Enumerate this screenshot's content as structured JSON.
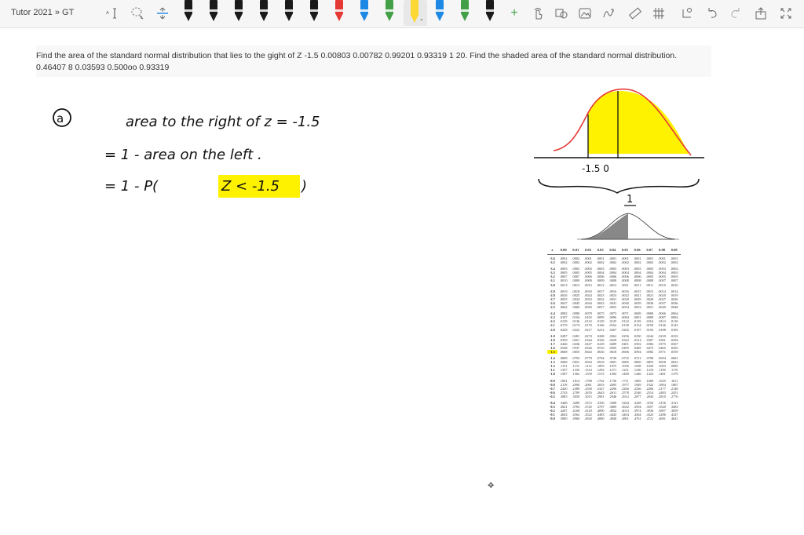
{
  "toolbar": {
    "app_title": "Tutor 2021 » GT",
    "icons": [
      "select-text-icon",
      "lasso-icon",
      "insert-space-icon",
      "pen-icon",
      "plus-icon",
      "touch-icon",
      "shapes-icon",
      "image-icon",
      "math-icon",
      "ruler-icon",
      "eraser-icon",
      "zoom-icon",
      "undo-icon",
      "redo-icon",
      "share-icon",
      "fullscreen-icon"
    ],
    "pen_colors": [
      "#1a1a1a",
      "#1a1a1a",
      "#1a1a1a",
      "#1a1a1a",
      "#1a1a1a",
      "#1a1a1a",
      "#e53935",
      "#1e88e5",
      "#fdd835",
      "#1e88e5",
      "#43a047",
      "#fb8c00",
      "#1a1a1a"
    ],
    "plus_label": "+"
  },
  "question": {
    "text": "Find the area of the standard normal distribution that lies to the gight of Z -1.5 0.00803 0.00782 0.99201 0.93319 1 20. Find the shaded area of the standard normal distribution.",
    "line2": "0.46407 8 0.03593 0.500oo 0.93319"
  },
  "notes": {
    "label_a": "a",
    "line1": "area   to the  right  of   z = -1.5",
    "line2": "= 1  -  area   on the  left .",
    "line3_prefix": "= 1  -   P(",
    "line3_highlight": "Z < -1.5",
    "line3_suffix": ")",
    "curve_label": "-1.5  0",
    "table_ref": "1"
  },
  "ztable": {
    "headers": [
      "z",
      "0.00",
      "0.01",
      "0.02",
      "0.03",
      "0.04",
      "0.05",
      "0.06",
      "0.07",
      "0.08",
      "0.09"
    ],
    "groups": [
      [
        [
          "-3.6",
          ".0002",
          ".0002",
          ".0001",
          ".0001",
          ".0001",
          ".0001",
          ".0001",
          ".0001",
          ".0001",
          ".0001"
        ],
        [
          "-3.5",
          ".0002",
          ".0002",
          ".0002",
          ".0002",
          ".0002",
          ".0002",
          ".0002",
          ".0002",
          ".0002",
          ".0002"
        ]
      ],
      [
        [
          "-3.4",
          ".0003",
          ".0003",
          ".0003",
          ".0003",
          ".0003",
          ".0003",
          ".0003",
          ".0003",
          ".0003",
          ".0002"
        ],
        [
          "-3.3",
          ".0005",
          ".0005",
          ".0005",
          ".0004",
          ".0004",
          ".0004",
          ".0004",
          ".0004",
          ".0004",
          ".0003"
        ],
        [
          "-3.2",
          ".0007",
          ".0007",
          ".0006",
          ".0006",
          ".0006",
          ".0006",
          ".0006",
          ".0005",
          ".0005",
          ".0005"
        ],
        [
          "-3.1",
          ".0010",
          ".0009",
          ".0009",
          ".0009",
          ".0008",
          ".0008",
          ".0008",
          ".0008",
          ".0007",
          ".0007"
        ],
        [
          "-3.0",
          ".0013",
          ".0013",
          ".0013",
          ".0012",
          ".0012",
          ".0011",
          ".0011",
          ".0011",
          ".0010",
          ".0010"
        ]
      ],
      [
        [
          "-2.9",
          ".0019",
          ".0018",
          ".0018",
          ".0017",
          ".0016",
          ".0016",
          ".0015",
          ".0015",
          ".0014",
          ".0014"
        ],
        [
          "-2.8",
          ".0026",
          ".0025",
          ".0024",
          ".0023",
          ".0023",
          ".0022",
          ".0021",
          ".0021",
          ".0020",
          ".0019"
        ],
        [
          "-2.7",
          ".0035",
          ".0034",
          ".0033",
          ".0032",
          ".0031",
          ".0030",
          ".0029",
          ".0028",
          ".0027",
          ".0026"
        ],
        [
          "-2.6",
          ".0047",
          ".0045",
          ".0044",
          ".0043",
          ".0041",
          ".0040",
          ".0039",
          ".0038",
          ".0037",
          ".0036"
        ],
        [
          "-2.5",
          ".0062",
          ".0060",
          ".0059",
          ".0057",
          ".0055",
          ".0054",
          ".0052",
          ".0051",
          ".0049",
          ".0048"
        ]
      ],
      [
        [
          "-2.4",
          ".0082",
          ".0080",
          ".0078",
          ".0075",
          ".0073",
          ".0071",
          ".0069",
          ".0068",
          ".0066",
          ".0064"
        ],
        [
          "-2.3",
          ".0107",
          ".0104",
          ".0102",
          ".0099",
          ".0096",
          ".0094",
          ".0091",
          ".0089",
          ".0087",
          ".0084"
        ],
        [
          "-2.2",
          ".0139",
          ".0136",
          ".0132",
          ".0129",
          ".0125",
          ".0122",
          ".0119",
          ".0116",
          ".0113",
          ".0110"
        ],
        [
          "-2.1",
          ".0179",
          ".0174",
          ".0170",
          ".0166",
          ".0162",
          ".0158",
          ".0154",
          ".0150",
          ".0146",
          ".0143"
        ],
        [
          "-2.0",
          ".0228",
          ".0222",
          ".0217",
          ".0212",
          ".0207",
          ".0202",
          ".0197",
          ".0192",
          ".0188",
          ".0183"
        ]
      ],
      [
        [
          "-1.9",
          ".0287",
          ".0281",
          ".0274",
          ".0268",
          ".0262",
          ".0256",
          ".0250",
          ".0244",
          ".0239",
          ".0233"
        ],
        [
          "-1.8",
          ".0359",
          ".0351",
          ".0344",
          ".0336",
          ".0329",
          ".0322",
          ".0314",
          ".0307",
          ".0301",
          ".0294"
        ],
        [
          "-1.7",
          ".0446",
          ".0436",
          ".0427",
          ".0418",
          ".0409",
          ".0401",
          ".0392",
          ".0384",
          ".0375",
          ".0367"
        ],
        [
          "-1.6",
          ".0548",
          ".0537",
          ".0526",
          ".0516",
          ".0505",
          ".0495",
          ".0485",
          ".0475",
          ".0465",
          ".0455"
        ],
        [
          "-1.5",
          ".0668",
          ".0655",
          ".0643",
          ".0630",
          ".0618",
          ".0606",
          ".0594",
          ".0582",
          ".0571",
          ".0559"
        ]
      ],
      [
        [
          "-1.4",
          ".0808",
          ".0793",
          ".0778",
          ".0764",
          ".0749",
          ".0735",
          ".0721",
          ".0708",
          ".0694",
          ".0681"
        ],
        [
          "-1.3",
          ".0968",
          ".0951",
          ".0934",
          ".0918",
          ".0901",
          ".0885",
          ".0869",
          ".0853",
          ".0838",
          ".0823"
        ],
        [
          "-1.2",
          ".1151",
          ".1131",
          ".1112",
          ".1093",
          ".1075",
          ".1056",
          ".1038",
          ".1020",
          ".1003",
          ".0985"
        ],
        [
          "-1.1",
          ".1357",
          ".1335",
          ".1314",
          ".1292",
          ".1271",
          ".1251",
          ".1230",
          ".1210",
          ".1190",
          ".1170"
        ],
        [
          "-1.0",
          ".1587",
          ".1562",
          ".1539",
          ".1515",
          ".1492",
          ".1469",
          ".1446",
          ".1423",
          ".1401",
          ".1379"
        ]
      ],
      [
        [
          "-0.9",
          ".1841",
          ".1814",
          ".1788",
          ".1762",
          ".1736",
          ".1711",
          ".1685",
          ".1660",
          ".1635",
          ".1611"
        ],
        [
          "-0.8",
          ".2119",
          ".2090",
          ".2061",
          ".2033",
          ".2005",
          ".1977",
          ".1949",
          ".1922",
          ".1894",
          ".1867"
        ],
        [
          "-0.7",
          ".2420",
          ".2389",
          ".2358",
          ".2327",
          ".2296",
          ".2266",
          ".2236",
          ".2206",
          ".2177",
          ".2148"
        ],
        [
          "-0.6",
          ".2743",
          ".2709",
          ".2676",
          ".2643",
          ".2611",
          ".2578",
          ".2546",
          ".2514",
          ".2483",
          ".2451"
        ],
        [
          "-0.5",
          ".3085",
          ".3050",
          ".3015",
          ".2981",
          ".2946",
          ".2912",
          ".2877",
          ".2843",
          ".2810",
          ".2776"
        ]
      ],
      [
        [
          "-0.4",
          ".3446",
          ".3409",
          ".3372",
          ".3336",
          ".3300",
          ".3264",
          ".3228",
          ".3192",
          ".3156",
          ".3121"
        ],
        [
          "-0.3",
          ".3821",
          ".3783",
          ".3745",
          ".3707",
          ".3669",
          ".3632",
          ".3594",
          ".3557",
          ".3520",
          ".3483"
        ],
        [
          "-0.2",
          ".4207",
          ".4168",
          ".4129",
          ".4090",
          ".4052",
          ".4013",
          ".3974",
          ".3936",
          ".3897",
          ".3859"
        ],
        [
          "-0.1",
          ".4602",
          ".4562",
          ".4522",
          ".4483",
          ".4443",
          ".4404",
          ".4364",
          ".4325",
          ".4286",
          ".4247"
        ],
        [
          "-0.0",
          ".5000",
          ".4960",
          ".4920",
          ".4880",
          ".4840",
          ".4801",
          ".4761",
          ".4721",
          ".4681",
          ".4641"
        ]
      ]
    ]
  }
}
